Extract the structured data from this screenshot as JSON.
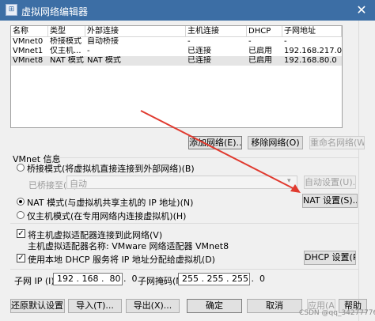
{
  "window": {
    "title": "虚拟网络编辑器",
    "close_glyph": "✕",
    "icon_glyph": "⊞"
  },
  "table": {
    "headers": [
      "名称",
      "类型",
      "外部连接",
      "主机连接",
      "DHCP",
      "子网地址"
    ],
    "rows": [
      [
        "VMnet0",
        "桥接模式",
        "自动桥接",
        "-",
        "-",
        "-"
      ],
      [
        "VMnet1",
        "仅主机...",
        "-",
        "已连接",
        "已启用",
        "192.168.217.0"
      ],
      [
        "VMnet8",
        "NAT 模式",
        "NAT 模式",
        "已连接",
        "已启用",
        "192.168.80.0"
      ]
    ]
  },
  "table_buttons": {
    "add": "添加网络(E)...",
    "remove": "移除网络(O)",
    "rename": "重命名网络(W)..."
  },
  "vmnet_info": {
    "heading": "VMnet 信息",
    "bridge_mode": "桥接模式(将虚拟机直接连接到外部网络)(B)",
    "bridged_to_label": "已桥接至(G):",
    "bridged_to_value": "自动",
    "auto_settings": "自动设置(U)...",
    "nat_mode": "NAT 模式(与虚拟机共享主机的 IP 地址)(N)",
    "nat_settings": "NAT 设置(S)...",
    "host_only": "仅主机模式(在专用网络内连接虚拟机)(H)",
    "connect_adapter": "将主机虚拟适配器连接到此网络(V)",
    "adapter_name": "主机虚拟适配器名称: VMware 网络适配器 VMnet8",
    "use_dhcp": "使用本地 DHCP 服务将 IP 地址分配给虚拟机(D)",
    "dhcp_settings": "DHCP 设置(P)...",
    "subnet_ip_label": "子网 IP (I):",
    "subnet_ip": "192 . 168 .  80 .  0",
    "subnet_mask_label": "子网掩码(M):",
    "subnet_mask": "255 . 255 . 255 .  0",
    "selected_mode": "nat",
    "connect_adapter_checked": true,
    "use_dhcp_checked": true
  },
  "footer_buttons": {
    "restore": "还原默认设置(R)",
    "import": "导入(T)...",
    "export": "导出(X)...",
    "ok": "确定",
    "cancel": "取消",
    "apply": "应用(A)",
    "help": "帮助"
  },
  "watermark": "CSDN @qq_34277776",
  "colors": {
    "title_bar": "#3c6ea5",
    "annotation_arrow": "#e03a2f",
    "selected_row": "#e5e5e5"
  }
}
